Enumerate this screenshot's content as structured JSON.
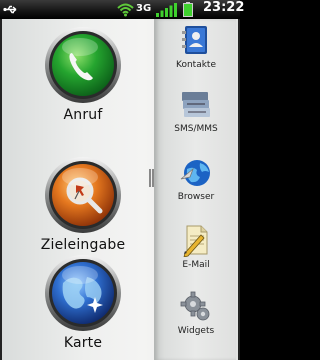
{
  "status_bar": {
    "network": "3G",
    "time": "23:22",
    "icons": [
      "usb-icon",
      "wifi-icon",
      "signal-icon",
      "battery-icon"
    ]
  },
  "main_apps": [
    {
      "label": "Anruf",
      "icon": "phone-icon",
      "color": "#1f9a2e"
    },
    {
      "label": "Zieleingabe",
      "icon": "pin-search-icon",
      "color": "#d8661a"
    },
    {
      "label": "Karte",
      "icon": "map-globe-icon",
      "color": "#2c5fb8"
    }
  ],
  "dock": [
    {
      "label": "Kontakte",
      "icon": "contacts-book-icon"
    },
    {
      "label": "SMS/MMS",
      "icon": "messages-icon"
    },
    {
      "label": "Browser",
      "icon": "globe-browser-icon"
    },
    {
      "label": "E-Mail",
      "icon": "email-letter-icon"
    },
    {
      "label": "Widgets",
      "icon": "gear-icon"
    }
  ]
}
